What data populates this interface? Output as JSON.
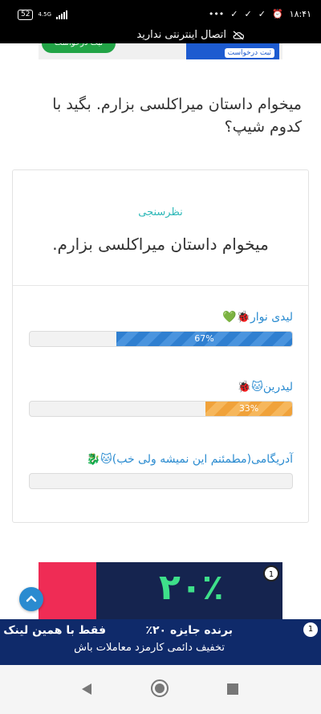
{
  "status_bar": {
    "battery": "52",
    "network": "4.5G",
    "time": "۱۸:۴۱",
    "dots": "•••"
  },
  "connectivity": {
    "message": "اتصال اینترنتی ندارید"
  },
  "top_ad": {
    "green_button": "ثبت درخواست",
    "blue_button": "ثبت درخواست"
  },
  "question": {
    "text": "میخوام داستان میراکلسی بزارم. بگید با کدوم شیپ؟"
  },
  "poll": {
    "kicker": "نظرسنجی",
    "title": "میخوام داستان میراکلسی بزارم.",
    "options": [
      {
        "label": "لیدی نوار🐞💚",
        "percent_text": "67%",
        "percent": 67,
        "color": "#2f7fd0"
      },
      {
        "label": "لیدرین🐱🐞",
        "percent_text": "33%",
        "percent": 33,
        "color": "#f0a23a"
      },
      {
        "label": "آدریگامی(مطمئنم این نمیشه ولی خب)🐱🐉",
        "percent_text": "",
        "percent": 0,
        "color": "#cccccc"
      }
    ]
  },
  "bottom_ad": {
    "big_percent": "۲۰٪",
    "badge": "1",
    "strip_line1": "برنده جایزه ۲۰٪",
    "strip_line2": "فقط با همین لینک",
    "strip_line3": "تخفیف دائمی کارمزد معاملات باش",
    "strip_badge": "1"
  },
  "icons": {
    "cloud": "cloud-off-icon",
    "scroll_top": "chevron-up-icon",
    "back": "nav-back-icon",
    "home": "nav-home-icon",
    "recent": "nav-recent-icon"
  }
}
